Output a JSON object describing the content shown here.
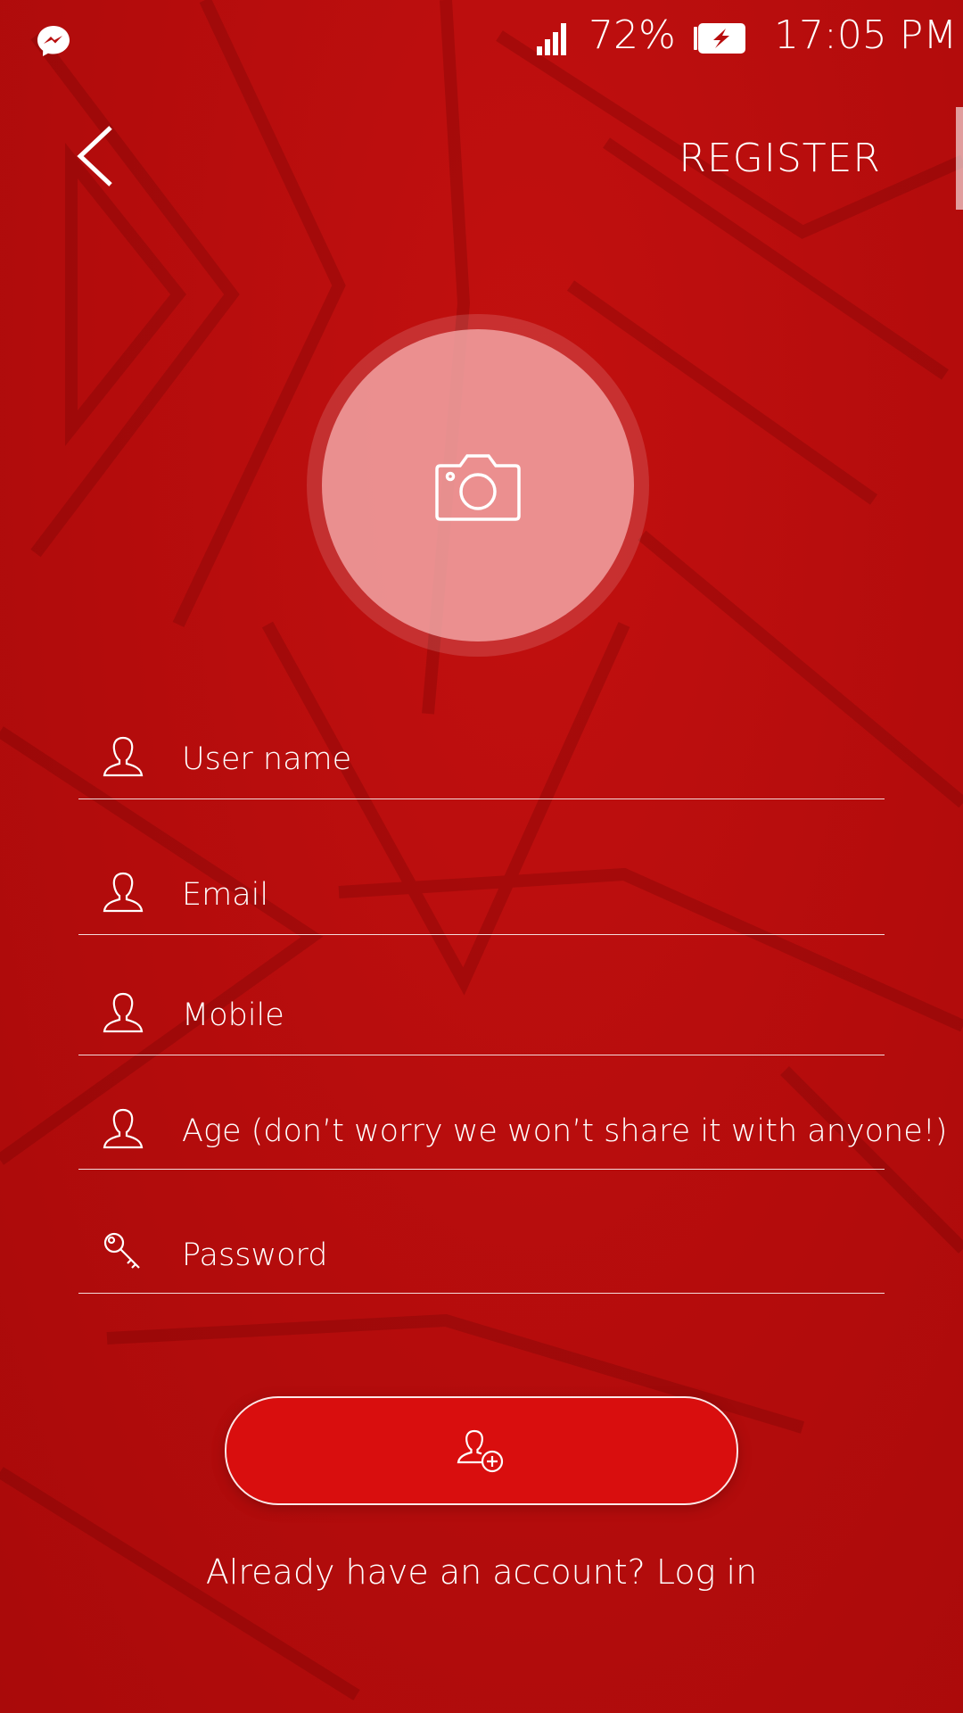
{
  "status_bar": {
    "battery_percent": "72%",
    "time": "17:05 PM",
    "icons": [
      "messenger-icon",
      "signal-icon",
      "battery-charging-icon"
    ]
  },
  "header": {
    "title": "REGISTER",
    "back_icon": "chevron-left-icon"
  },
  "avatar": {
    "icon": "camera-icon"
  },
  "form": {
    "fields": [
      {
        "label": "User name",
        "icon": "user-icon"
      },
      {
        "label": "Email",
        "icon": "user-icon"
      },
      {
        "label": "Mobile",
        "icon": "user-icon"
      },
      {
        "label": "Age (don’t worry we won’t share it with anyone!)",
        "icon": "user-icon"
      },
      {
        "label": "Password",
        "icon": "key-icon"
      }
    ]
  },
  "submit": {
    "icon": "add-user-icon"
  },
  "footer": {
    "login_text": "Already have an account? Log in"
  },
  "colors": {
    "background": "#b80d0d",
    "button": "#d90e0e",
    "text": "#ffffff"
  }
}
